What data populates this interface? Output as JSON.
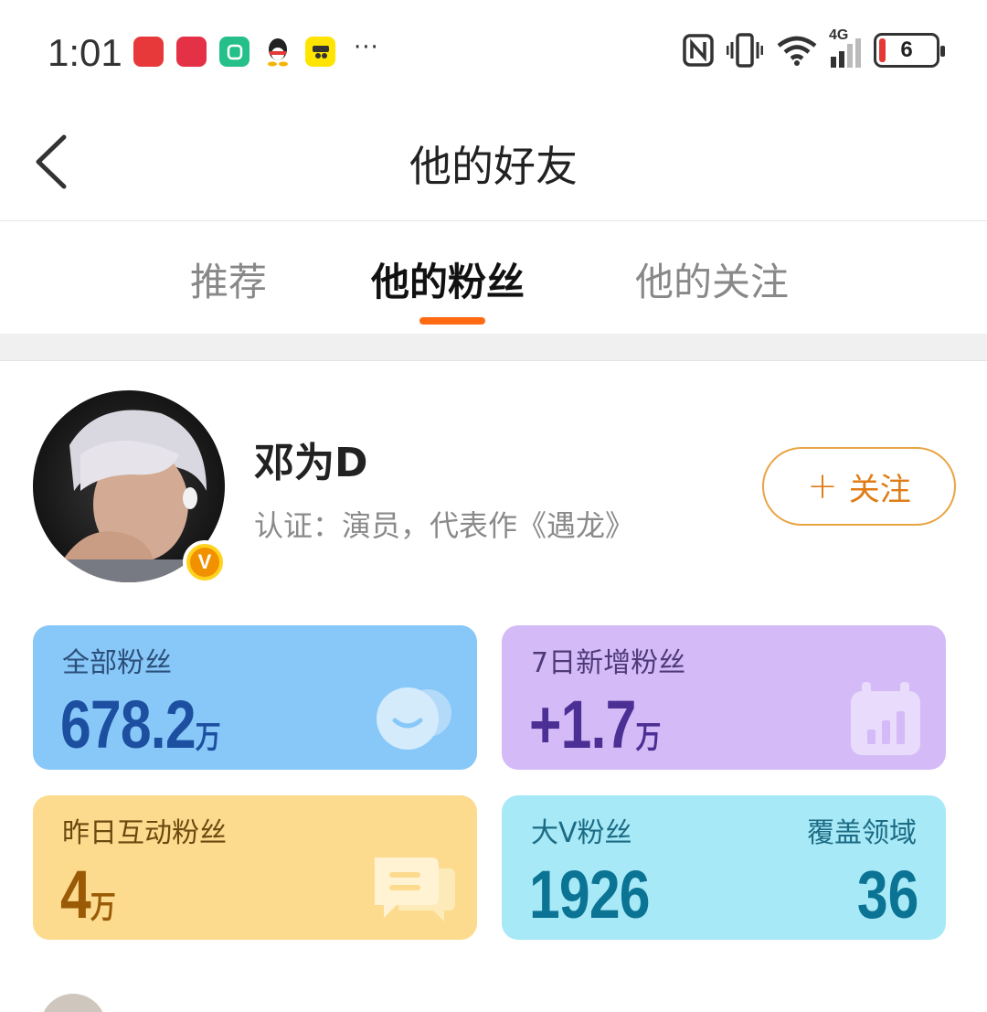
{
  "status_bar": {
    "time": "1:01",
    "network": "4G",
    "battery": "6",
    "app_icons": [
      "huawei-appgallery-icon",
      "red-app-icon",
      "mi-home-icon",
      "qq-icon",
      "xianyu-icon"
    ],
    "more": "···"
  },
  "header": {
    "title": "他的好友"
  },
  "tabs": [
    {
      "label": "推荐",
      "active": false
    },
    {
      "label": "他的粉丝",
      "active": true
    },
    {
      "label": "他的关注",
      "active": false
    }
  ],
  "profile": {
    "name": "邓为D",
    "description": "认证：演员，代表作《遇龙》",
    "verified_badge": "V",
    "follow_plus": "+",
    "follow_label": "关注"
  },
  "stats": {
    "total_fans": {
      "label": "全部粉丝",
      "value": "678.2",
      "unit": "万"
    },
    "new_fans_7d": {
      "label": "7日新增粉丝",
      "value": "+1.7",
      "unit": "万"
    },
    "interactive_fans": {
      "label": "昨日互动粉丝",
      "value": "4",
      "unit": "万"
    },
    "big_v_fans": {
      "label": "大V粉丝",
      "value": "1926",
      "domains_label": "覆盖领域",
      "domains_value": "36"
    }
  },
  "colors": {
    "accent": "#ff6a13",
    "follow_border": "#e9a443",
    "card_blue": "#88c8f8",
    "card_purple": "#d4bbf7",
    "card_yellow": "#fcdb8e",
    "card_cyan": "#a7e9f6"
  }
}
